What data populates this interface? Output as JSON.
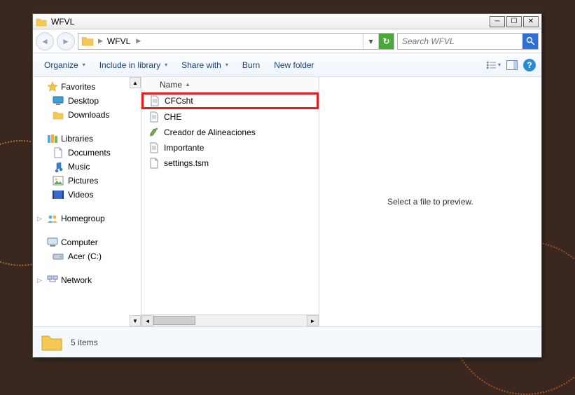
{
  "window": {
    "title": "WFVL"
  },
  "address": {
    "crumb": "WFVL"
  },
  "search": {
    "placeholder": "Search WFVL"
  },
  "toolbar": {
    "organize": "Organize",
    "include": "Include in library",
    "share": "Share with",
    "burn": "Burn",
    "newfolder": "New folder"
  },
  "nav": {
    "favorites": {
      "label": "Favorites",
      "items": [
        {
          "label": "Desktop"
        },
        {
          "label": "Downloads"
        }
      ]
    },
    "libraries": {
      "label": "Libraries",
      "items": [
        {
          "label": "Documents"
        },
        {
          "label": "Music"
        },
        {
          "label": "Pictures"
        },
        {
          "label": "Videos"
        }
      ]
    },
    "homegroup": {
      "label": "Homegroup"
    },
    "computer": {
      "label": "Computer",
      "items": [
        {
          "label": "Acer (C:)"
        }
      ]
    },
    "network": {
      "label": "Network"
    }
  },
  "columns": {
    "name": "Name"
  },
  "files": [
    {
      "name": "CFCsht"
    },
    {
      "name": "CHE"
    },
    {
      "name": "Creador de Alineaciones"
    },
    {
      "name": "Importante"
    },
    {
      "name": "settings.tsm"
    }
  ],
  "preview": {
    "empty": "Select a file to preview."
  },
  "status": {
    "count": "5 items"
  }
}
